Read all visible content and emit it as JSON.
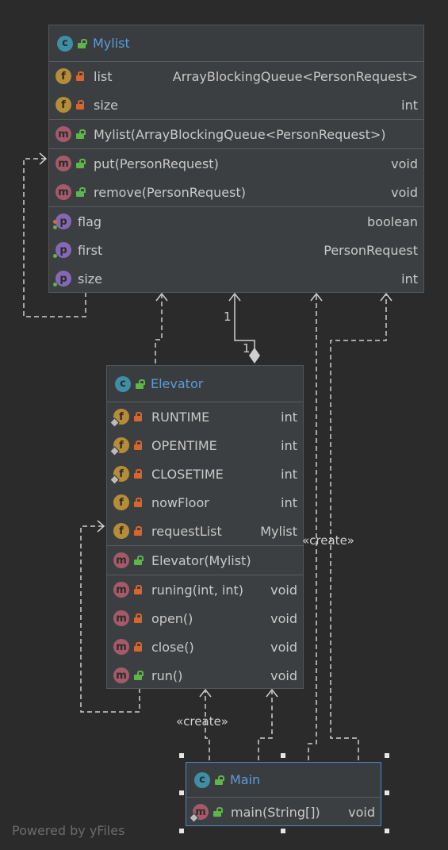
{
  "classes": {
    "mylist": {
      "icon": "class-icon",
      "name": "Mylist",
      "fields": [
        {
          "icon": "field-icon",
          "name": "list",
          "type": "ArrayBlockingQueue<PersonRequest>"
        },
        {
          "icon": "field-icon",
          "name": "size",
          "type": "int"
        }
      ],
      "constructors": [
        {
          "icon": "method-icon",
          "name": "Mylist(ArrayBlockingQueue<PersonRequest>)",
          "type": ""
        }
      ],
      "methods": [
        {
          "icon": "method-icon",
          "name": "put(PersonRequest)",
          "type": "void"
        },
        {
          "icon": "method-icon",
          "name": "remove(PersonRequest)",
          "type": "void"
        }
      ],
      "properties": [
        {
          "icon": "property-icon",
          "name": "flag",
          "type": "boolean"
        },
        {
          "icon": "property-icon",
          "name": "first",
          "type": "PersonRequest"
        },
        {
          "icon": "property-icon",
          "name": "size",
          "type": "int"
        }
      ]
    },
    "elevator": {
      "icon": "class-icon",
      "name": "Elevator",
      "fields": [
        {
          "icon": "field-icon",
          "name": "RUNTIME",
          "type": "int"
        },
        {
          "icon": "field-icon",
          "name": "OPENTIME",
          "type": "int"
        },
        {
          "icon": "field-icon",
          "name": "CLOSETIME",
          "type": "int"
        },
        {
          "icon": "field-icon",
          "name": "nowFloor",
          "type": "int"
        },
        {
          "icon": "field-icon",
          "name": "requestList",
          "type": "Mylist"
        }
      ],
      "constructors": [
        {
          "icon": "method-icon",
          "name": "Elevator(Mylist)",
          "type": ""
        }
      ],
      "methods": [
        {
          "icon": "method-icon",
          "name": "runing(int, int)",
          "type": "void"
        },
        {
          "icon": "method-icon",
          "name": "open()",
          "type": "void"
        },
        {
          "icon": "method-icon",
          "name": "close()",
          "type": "void"
        },
        {
          "icon": "method-icon",
          "name": "run()",
          "type": "void"
        }
      ]
    },
    "main": {
      "icon": "class-icon",
      "name": "Main",
      "methods": [
        {
          "icon": "method-icon",
          "name": "main(String[])",
          "type": "void"
        }
      ]
    }
  },
  "edge_labels": {
    "create_elevator": "«create»",
    "create_mylist": "«create»",
    "multiplicity_top": "1",
    "multiplicity_bottom": "1"
  },
  "footer": "Powered by yFiles",
  "colors": {
    "background": "#2b2b2b",
    "box": "#3c3f41",
    "class_name": "#5c9bd6",
    "selection": "#4a88c7"
  }
}
